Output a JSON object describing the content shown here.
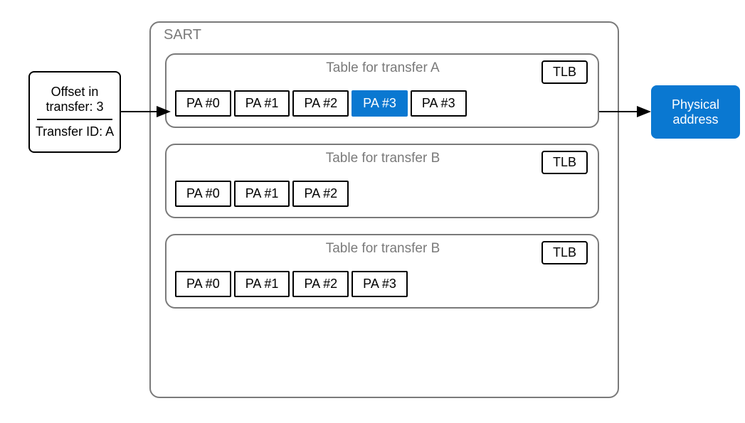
{
  "request": {
    "offset_line": "Offset in transfer: 3",
    "id_line": "Transfer ID: A"
  },
  "sart": {
    "title": "SART",
    "tables": [
      {
        "title": "Table for transfer A",
        "tlb": "TLB",
        "entries": [
          "PA #0",
          "PA #1",
          "PA #2",
          "PA #3",
          "PA #3"
        ],
        "highlight_index": 3
      },
      {
        "title": "Table for transfer B",
        "tlb": "TLB",
        "entries": [
          "PA #0",
          "PA #1",
          "PA #2"
        ],
        "highlight_index": -1
      },
      {
        "title": "Table for transfer B",
        "tlb": "TLB",
        "entries": [
          "PA #0",
          "PA #1",
          "PA #2",
          "PA #3"
        ],
        "highlight_index": -1
      }
    ]
  },
  "output": {
    "label": "Physical address"
  },
  "colors": {
    "highlight": "#0a78d1",
    "muted": "#7a7a7a"
  }
}
